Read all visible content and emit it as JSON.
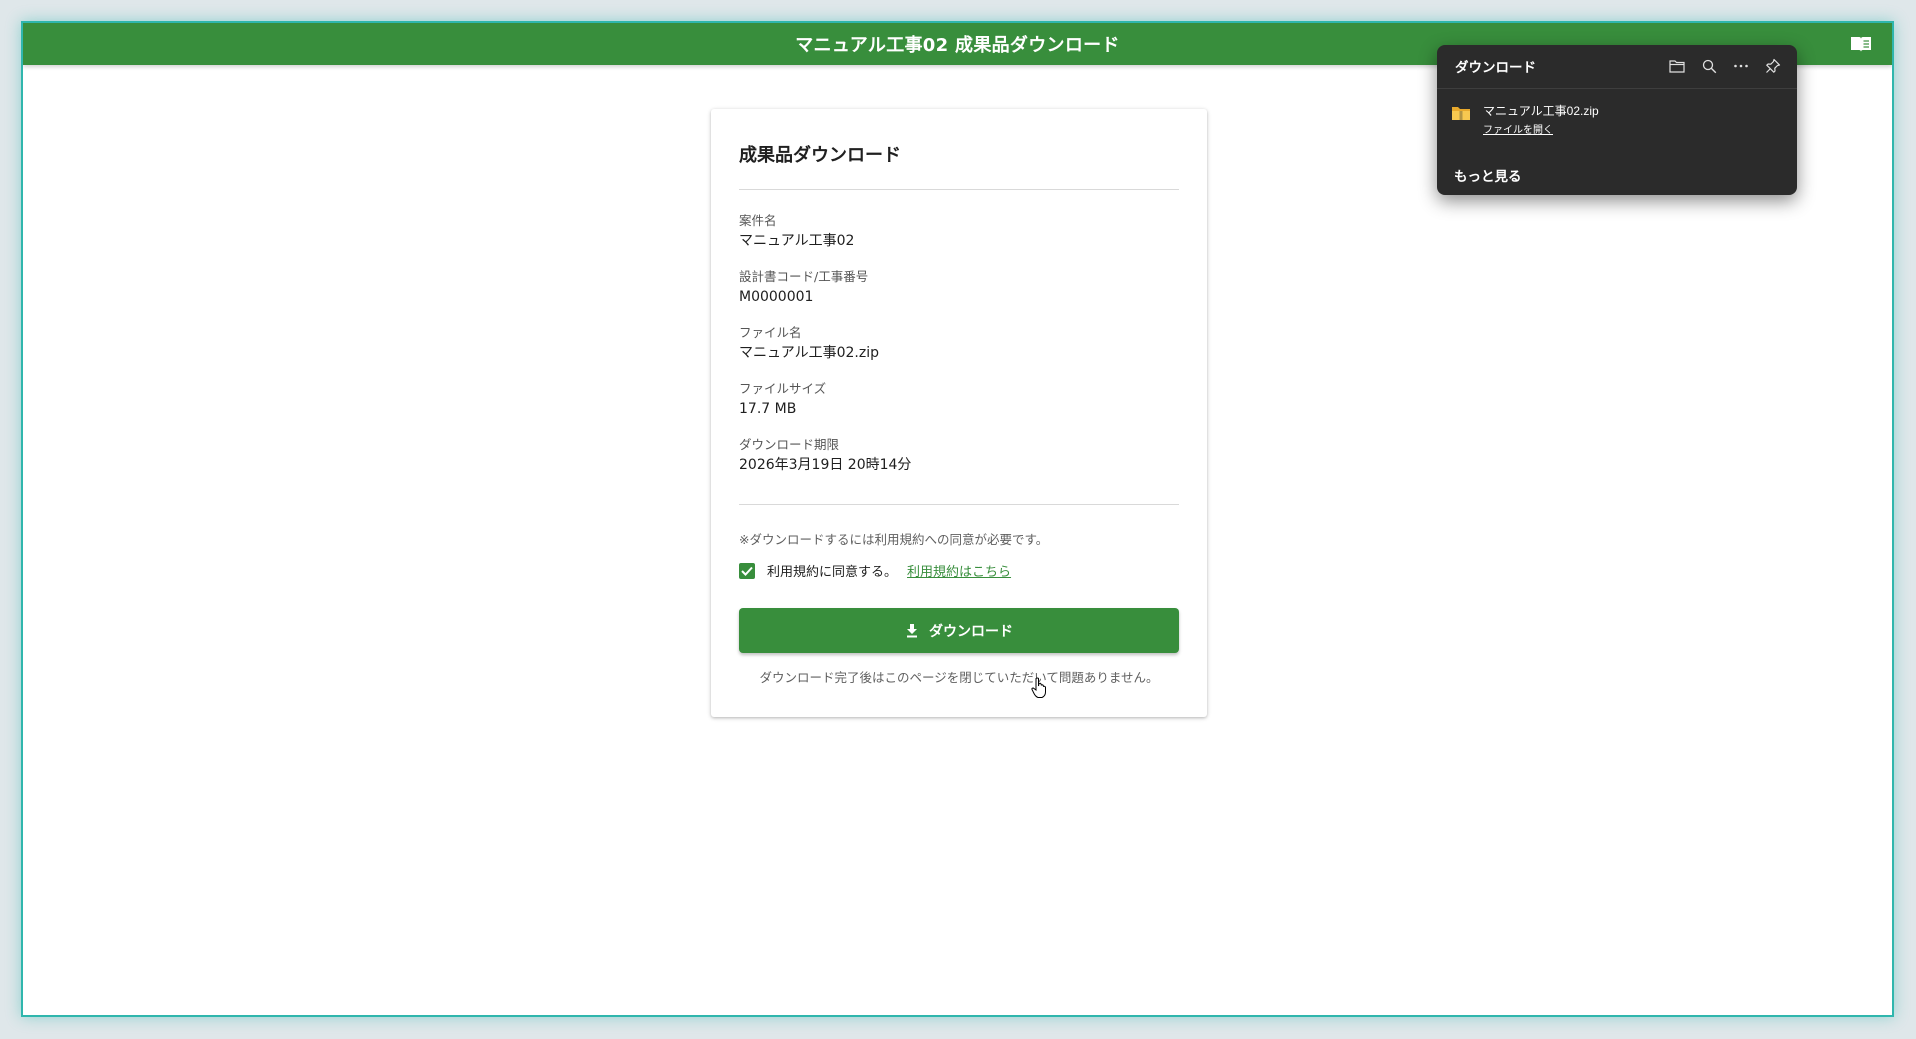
{
  "app": {
    "title": "マニュアル工事02 成果品ダウンロード",
    "manual_icon": "book-open-icon"
  },
  "card": {
    "title": "成果品ダウンロード",
    "fields": [
      {
        "label": "案件名",
        "value": "マニュアル工事02"
      },
      {
        "label": "設計書コード/工事番号",
        "value": "M0000001"
      },
      {
        "label": "ファイル名",
        "value": "マニュアル工事02.zip"
      },
      {
        "label": "ファイルサイズ",
        "value": "17.7 MB"
      },
      {
        "label": "ダウンロード期限",
        "value": "2026年3月19日 20時14分"
      }
    ],
    "notice": "※ダウンロードするには利用規約への同意が必要です。",
    "agree_label": "利用規約に同意する。",
    "agree_checked": true,
    "terms_link": "利用規約はこちら",
    "download_button": "ダウンロード",
    "after_note": "ダウンロード完了後はこのページを閉じていただいて問題ありません。",
    "accent_color": "#388e3c"
  },
  "downloads_panel": {
    "title": "ダウンロード",
    "header_icons": [
      "folder-icon",
      "search-icon",
      "more-icon",
      "pin-icon"
    ],
    "item": {
      "filename": "マニュアル工事02.zip",
      "open_label": "ファイルを開く",
      "icon": "zip-folder-icon"
    },
    "more_label": "もっと見る"
  }
}
